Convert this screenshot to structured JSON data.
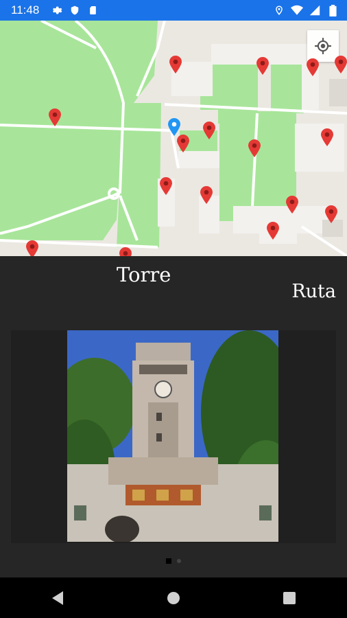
{
  "status_bar": {
    "time": "11:48",
    "left_icons": [
      "gear-icon",
      "shield-icon",
      "sim-card-icon"
    ],
    "right_icons": [
      "location-icon",
      "wifi-icon",
      "cell-signal-icon",
      "battery-icon"
    ],
    "background": "#1a73e8"
  },
  "map": {
    "marker_color": "#e53935",
    "user_marker_color": "#2196f3"
  },
  "panel": {
    "title": "Torre",
    "route_label": "Ruta"
  },
  "pager": {
    "pages": 2,
    "current_page": 1
  },
  "nav_bar": {
    "buttons": [
      "back-icon",
      "home-icon",
      "recents-icon"
    ]
  }
}
